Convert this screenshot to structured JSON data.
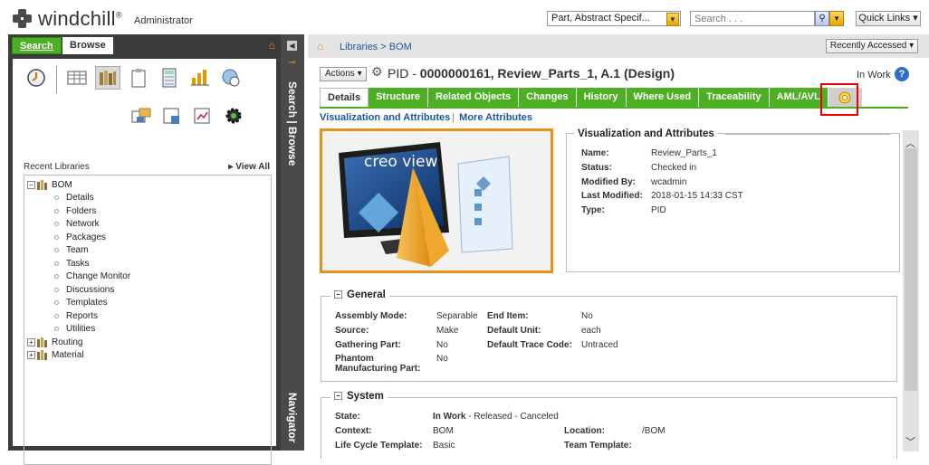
{
  "header": {
    "app_name": "windchill",
    "trademark": "®",
    "role": "Administrator",
    "type_select": "Part, Abstract Specif...",
    "search_placeholder": "Search . . .",
    "quick_links": "Quick Links ▾"
  },
  "left_panel": {
    "tab_search": "Search",
    "tab_browse": "Browse",
    "recent_libraries_label": "Recent Libraries",
    "view_all": "View All",
    "tree": {
      "root": "BOM",
      "children": [
        "Details",
        "Folders",
        "Network",
        "Packages",
        "Team",
        "Tasks",
        "Change Monitor",
        "Discussions",
        "Templates",
        "Reports",
        "Utilities"
      ],
      "siblings": [
        "Routing",
        "Material"
      ]
    }
  },
  "side_strip": {
    "search_browse": "Search | Browse",
    "navigator": "Navigator"
  },
  "breadcrumb": {
    "path": "Libraries > BOM",
    "recent": "Recently Accessed ▾"
  },
  "object": {
    "actions_label": "Actions ▾",
    "type_label": "PID - ",
    "title": "0000000161, Review_Parts_1, A.1 (Design)",
    "state": "In Work"
  },
  "tabs": [
    "Details",
    "Structure",
    "Related Objects",
    "Changes",
    "History",
    "Where Used",
    "Traceability",
    "AML/AVL"
  ],
  "sublinks": {
    "visualization": "Visualization and Attributes",
    "more": "More Attributes"
  },
  "thumbnail": {
    "brand": "creo view"
  },
  "vis_attrs": {
    "heading": "Visualization and Attributes",
    "rows": [
      {
        "k": "Name:",
        "v": "Review_Parts_1"
      },
      {
        "k": "Status:",
        "v": "Checked in"
      },
      {
        "k": "Modified By:",
        "v": "wcadmin"
      },
      {
        "k": "Last Modified:",
        "v": "2018-01-15 14:33 CST"
      },
      {
        "k": "Type:",
        "v": "PID"
      }
    ]
  },
  "general": {
    "heading": "General",
    "assembly_mode_k": "Assembly Mode:",
    "assembly_mode_v": "Separable",
    "end_item_k": "End Item:",
    "end_item_v": "No",
    "source_k": "Source:",
    "source_v": "Make",
    "default_unit_k": "Default Unit:",
    "default_unit_v": "each",
    "gathering_k": "Gathering Part:",
    "gathering_v": "No",
    "trace_k": "Default Trace Code:",
    "trace_v": "Untraced",
    "phantom_k1": "Phantom",
    "phantom_k2": "Manufacturing Part:",
    "phantom_v": "No"
  },
  "system": {
    "heading": "System",
    "state_k": "State:",
    "state_v1": "In Work",
    "state_v2": " - Released - Canceled",
    "context_k": "Context:",
    "context_v": "BOM",
    "location_k": "Location:",
    "location_v": "/BOM",
    "lifecycle_k": "Life Cycle Template:",
    "lifecycle_v": "Basic",
    "team_k": "Team Template:"
  },
  "colors": {
    "accent_green": "#4caf24",
    "link_blue": "#1a57a6",
    "highlight_red": "#e00000",
    "thumb_border": "#e8921c"
  }
}
